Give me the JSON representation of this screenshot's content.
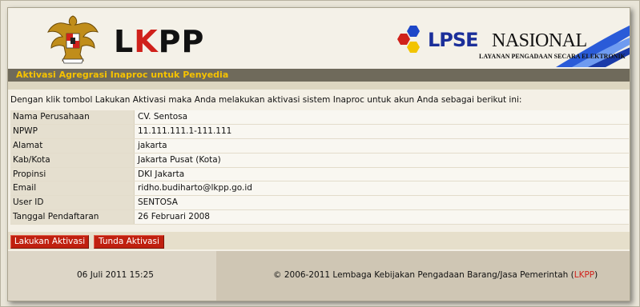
{
  "header": {
    "brand_left": {
      "prefix": "L",
      "accent": "K",
      "suffix": "PP"
    },
    "lpse_label": "LPSE",
    "nasional_label": "NASIONAL",
    "tagline": "LAYANAN PENGADAAN SECARA ELEKTRONIK"
  },
  "page": {
    "title": "Aktivasi Agregrasi Inaproc untuk Penyedia",
    "intro": "Dengan klik tombol Lakukan Aktivasi maka Anda melakukan aktivasi sistem Inaproc untuk akun Anda sebagai berikut ini:"
  },
  "details": [
    {
      "label": "Nama Perusahaan",
      "value": "CV. Sentosa"
    },
    {
      "label": "NPWP",
      "value": "11.111.111.1-111.111"
    },
    {
      "label": "Alamat",
      "value": "jakarta"
    },
    {
      "label": "Kab/Kota",
      "value": "Jakarta Pusat (Kota)"
    },
    {
      "label": "Propinsi",
      "value": "DKI Jakarta"
    },
    {
      "label": "Email",
      "value": "ridho.budiharto@lkpp.go.id"
    },
    {
      "label": "User ID",
      "value": "SENTOSA"
    },
    {
      "label": "Tanggal Pendaftaran",
      "value": "26 Februari 2008"
    }
  ],
  "actions": {
    "activate_label": "Lakukan Aktivasi",
    "postpone_label": "Tunda Aktivasi"
  },
  "footer": {
    "datetime": "06 Juli 2011 15:25",
    "copyright_prefix": "© 2006-2011 Lembaga Kebijakan Pengadaan Barang/Jasa Pemerintah (",
    "copyright_link": "LKPP",
    "copyright_suffix": ")"
  },
  "icons": {
    "garuda": "garuda-emblem-icon",
    "lpse_logo": "lpse-hexagon-icon"
  },
  "colors": {
    "accent_red": "#c0200f",
    "title_yellow": "#f6c200",
    "title_bar": "#6f6a5b",
    "lpse_blue": "#1b2f9a"
  }
}
